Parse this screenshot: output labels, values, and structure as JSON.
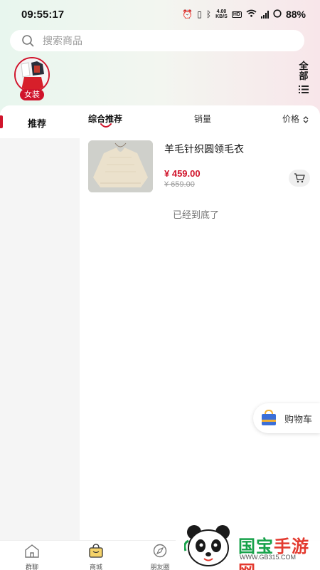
{
  "status_bar": {
    "time": "09:55:17",
    "net_speed_top": "4.00",
    "net_speed_bottom": "KB/S",
    "hd_badge": "HD",
    "battery": "88%"
  },
  "search": {
    "placeholder": "搜索商品"
  },
  "category": {
    "label": "女装"
  },
  "all_button": {
    "label_1": "全",
    "label_2": "部"
  },
  "sidebar": {
    "items": [
      {
        "label": "推荐",
        "active": true
      }
    ]
  },
  "sort_tabs": [
    {
      "label": "综合推荐",
      "active": true
    },
    {
      "label": "销量",
      "active": false
    },
    {
      "label": "价格",
      "active": false
    }
  ],
  "products": [
    {
      "title": "羊毛针织圆领毛衣",
      "price": "¥ 459.00",
      "original_price": "¥ 659.00"
    }
  ],
  "end_message": "已经到底了",
  "floating_cart": {
    "label": "购物车"
  },
  "bottom_nav": [
    {
      "label": "群聊",
      "icon": "house-icon"
    },
    {
      "label": "商城",
      "icon": "shop-bag-icon",
      "active": true
    },
    {
      "label": "朋友圈",
      "icon": "compass-icon"
    }
  ],
  "watermark": {
    "brand_1": "国宝",
    "brand_2": "手游网",
    "url": "WWW.GB315.COM"
  },
  "colors": {
    "accent": "#d0142b",
    "watermark_green": "#17a24a"
  }
}
